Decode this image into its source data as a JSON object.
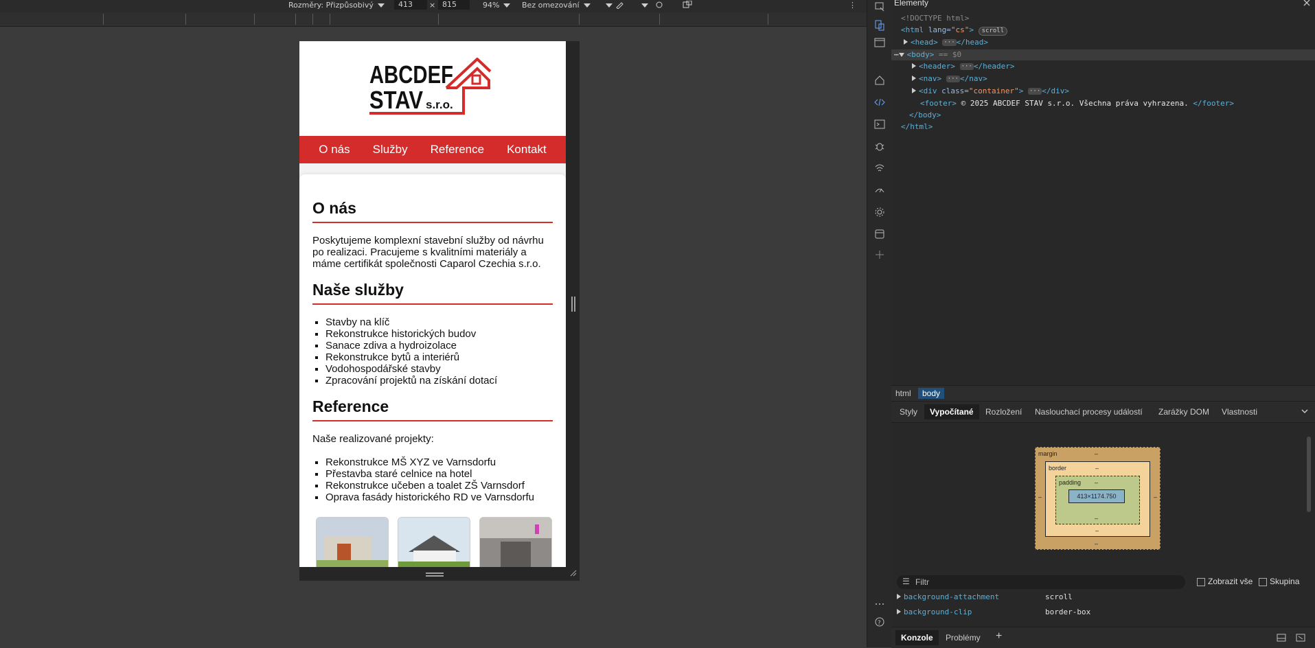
{
  "emulation": {
    "dimensions_label": "Rozměry: Přizpůsobivý",
    "width": "413",
    "height": "815",
    "times": "×",
    "zoom": "94%",
    "throttle": "Bez omezování",
    "more": "⋮"
  },
  "site": {
    "logo_line1": "ABCDEF",
    "logo_line2": "STAV",
    "logo_suffix": "s.r.o.",
    "nav": [
      "O nás",
      "Služby",
      "Reference",
      "Kontakt"
    ],
    "about_title": "O nás",
    "about_text": "Poskytujeme komplexní stavební služby od návrhu po realizaci. Pracujeme s kvalitními materiály a máme certifikát společnosti Caparol Czechia s.r.o.",
    "services_title": "Naše služby",
    "services": [
      "Stavby na klíč",
      "Rekonstrukce historických budov",
      "Sanace zdiva a hydroizolace",
      "Rekonstrukce bytů a interiérů",
      "Vodohospodářské stavby",
      "Zpracování projektů na získání dotací"
    ],
    "ref_title": "Reference",
    "ref_intro": "Naše realizované projekty:",
    "refs": [
      "Rekonstrukce MŠ XYZ ve Varnsdorfu",
      "Přestavba staré celnice na hotel",
      "Rekonstrukce učeben a toalet ZŠ Varnsdorf",
      "Oprava fasády historického RD ve Varnsdorfu"
    ]
  },
  "devtools": {
    "panel_title": "Elementy",
    "dom": {
      "doctype": "<!DOCTYPE html>",
      "html_open": "<html",
      "lang_attr": "lang",
      "lang_val": "\"cs\"",
      "scroll_badge": "scroll",
      "head": "<head>",
      "head_close": "</head>",
      "body": "<body>",
      "body_eq": "== $0",
      "header": "<header>",
      "header_close": "</header>",
      "nav": "<nav>",
      "nav_close": "</nav>",
      "div_open": "<div",
      "class_attr": "class",
      "class_val": "\"container\"",
      "div_close": "</div>",
      "footer": "<footer>",
      "footer_text": "© 2025 ABCDEF STAV s.r.o. Všechna práva vyhrazena.",
      "footer_close": "</footer>",
      "body_close": "</body>",
      "html_close": "</html>",
      "ellipsis": "···"
    },
    "breadcrumbs": [
      "html",
      "body"
    ],
    "tabs": [
      "Styly",
      "Vypočítané",
      "Rozložení",
      "Naslouchací procesy událostí",
      "Zarážky DOM",
      "Vlastnosti"
    ],
    "boxmodel": {
      "margin": "margin",
      "border": "border",
      "padding": "padding",
      "dash": "–",
      "content_size": "413×1174.750"
    },
    "filter_placeholder": "Filtr",
    "show_all": "Zobrazit vše",
    "group": "Skupina",
    "properties": [
      {
        "name": "background-attachment",
        "value": "scroll"
      },
      {
        "name": "background-clip",
        "value": "border-box"
      }
    ],
    "drawer_tabs": [
      "Konzole",
      "Problémy"
    ],
    "plus": "+"
  },
  "colors": {
    "brand_red": "#d42b2b",
    "selected_crumb": "#1f4f7a"
  }
}
